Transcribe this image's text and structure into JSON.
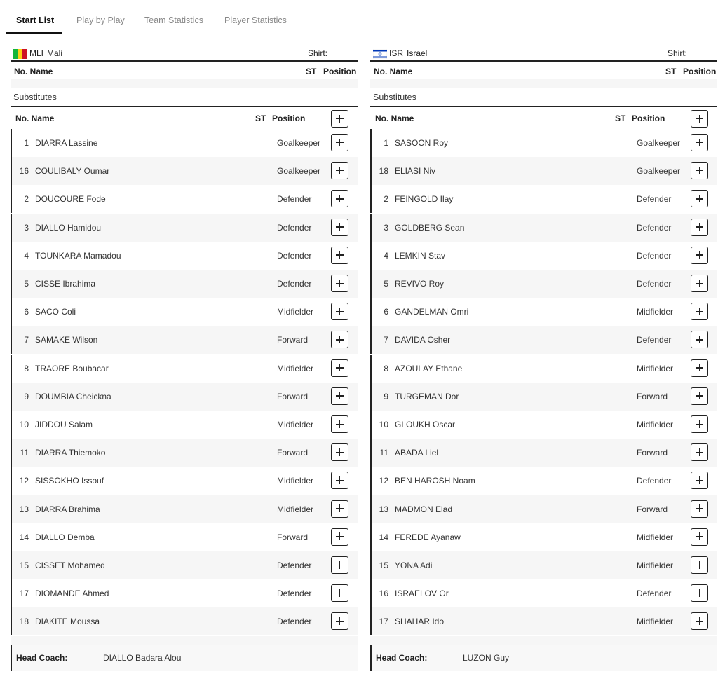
{
  "tabs": [
    {
      "label": "Start List",
      "active": true
    },
    {
      "label": "Play by Play",
      "active": false
    },
    {
      "label": "Team Statistics",
      "active": false
    },
    {
      "label": "Player Statistics",
      "active": false
    }
  ],
  "columns": {
    "no_name": "No. Name",
    "st": "ST",
    "position": "Position"
  },
  "substitutes_label": "Substitutes",
  "shirt_label": "Shirt:",
  "head_coach_label": "Head Coach:",
  "teams": [
    {
      "code": "MLI",
      "name": "Mali",
      "flag": "mali-flag",
      "coach": "DIALLO Badara Alou",
      "players": [
        {
          "no": "1",
          "name": "DIARRA Lassine",
          "position": "Goalkeeper"
        },
        {
          "no": "16",
          "name": "COULIBALY Oumar",
          "position": "Goalkeeper"
        },
        {
          "no": "2",
          "name": "DOUCOURE Fode",
          "position": "Defender"
        },
        {
          "no": "3",
          "name": "DIALLO Hamidou",
          "position": "Defender"
        },
        {
          "no": "4",
          "name": "TOUNKARA Mamadou",
          "position": "Defender"
        },
        {
          "no": "5",
          "name": "CISSE Ibrahima",
          "position": "Defender"
        },
        {
          "no": "6",
          "name": "SACO Coli",
          "position": "Midfielder"
        },
        {
          "no": "7",
          "name": "SAMAKE Wilson",
          "position": "Forward"
        },
        {
          "no": "8",
          "name": "TRAORE Boubacar",
          "position": "Midfielder"
        },
        {
          "no": "9",
          "name": "DOUMBIA Cheickna",
          "position": "Forward"
        },
        {
          "no": "10",
          "name": "JIDDOU Salam",
          "position": "Midfielder"
        },
        {
          "no": "11",
          "name": "DIARRA Thiemoko",
          "position": "Forward"
        },
        {
          "no": "12",
          "name": "SISSOKHO Issouf",
          "position": "Midfielder"
        },
        {
          "no": "13",
          "name": "DIARRA Brahima",
          "position": "Midfielder"
        },
        {
          "no": "14",
          "name": "DIALLO Demba",
          "position": "Forward"
        },
        {
          "no": "15",
          "name": "CISSET Mohamed",
          "position": "Defender"
        },
        {
          "no": "17",
          "name": "DIOMANDE Ahmed",
          "position": "Defender"
        },
        {
          "no": "18",
          "name": "DIAKITE Moussa",
          "position": "Defender"
        }
      ]
    },
    {
      "code": "ISR",
      "name": "Israel",
      "flag": "israel-flag",
      "coach": "LUZON Guy",
      "players": [
        {
          "no": "1",
          "name": "SASOON Roy",
          "position": "Goalkeeper"
        },
        {
          "no": "18",
          "name": "ELIASI Niv",
          "position": "Goalkeeper"
        },
        {
          "no": "2",
          "name": "FEINGOLD Ilay",
          "position": "Defender"
        },
        {
          "no": "3",
          "name": "GOLDBERG Sean",
          "position": "Defender"
        },
        {
          "no": "4",
          "name": "LEMKIN Stav",
          "position": "Defender"
        },
        {
          "no": "5",
          "name": "REVIVO Roy",
          "position": "Defender"
        },
        {
          "no": "6",
          "name": "GANDELMAN Omri",
          "position": "Midfielder"
        },
        {
          "no": "7",
          "name": "DAVIDA Osher",
          "position": "Defender"
        },
        {
          "no": "8",
          "name": "AZOULAY Ethane",
          "position": "Midfielder"
        },
        {
          "no": "9",
          "name": "TURGEMAN Dor",
          "position": "Forward"
        },
        {
          "no": "10",
          "name": "GLOUKH Oscar",
          "position": "Midfielder"
        },
        {
          "no": "11",
          "name": "ABADA Liel",
          "position": "Forward"
        },
        {
          "no": "12",
          "name": "BEN HAROSH Noam",
          "position": "Defender"
        },
        {
          "no": "13",
          "name": "MADMON Elad",
          "position": "Forward"
        },
        {
          "no": "14",
          "name": "FEREDE Ayanaw",
          "position": "Midfielder"
        },
        {
          "no": "15",
          "name": "YONA Adi",
          "position": "Midfielder"
        },
        {
          "no": "16",
          "name": "ISRAELOV Or",
          "position": "Defender"
        },
        {
          "no": "17",
          "name": "SHAHAR Ido",
          "position": "Midfielder"
        }
      ]
    }
  ]
}
